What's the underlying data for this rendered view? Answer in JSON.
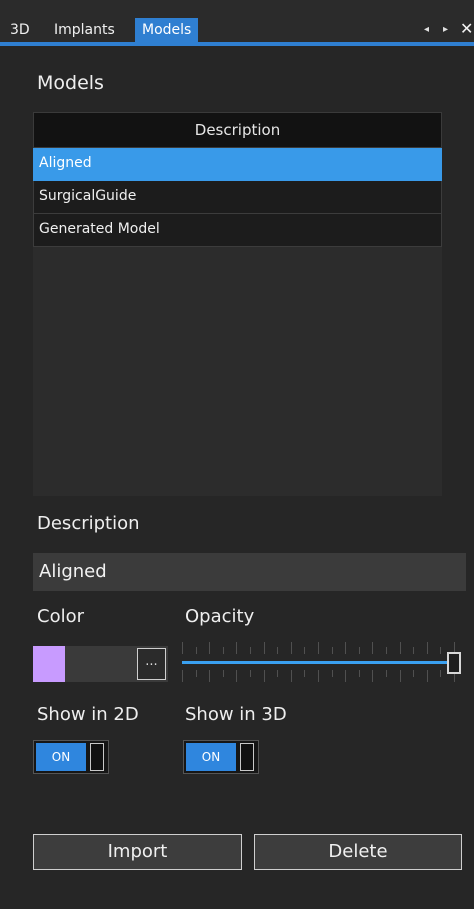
{
  "tabs": [
    {
      "label": "3D",
      "active": false
    },
    {
      "label": "Implants",
      "active": false
    },
    {
      "label": "Models",
      "active": true
    }
  ],
  "tab_nav": {
    "prev_glyph": "◂",
    "next_glyph": "▸",
    "close_glyph": "✕"
  },
  "panel": {
    "title": "Models",
    "list": {
      "header": "Description",
      "rows": [
        "Aligned",
        "SurgicalGuide",
        "Generated Model"
      ],
      "selected_index": 0
    },
    "description_label": "Description",
    "description_value": "Aligned",
    "color_label": "Color",
    "color_value": "#c89bff",
    "more_label": "...",
    "opacity_label": "Opacity",
    "opacity_value": 1.0,
    "show2d_label": "Show in 2D",
    "show2d_state": "ON",
    "show3d_label": "Show in 3D",
    "show3d_state": "ON",
    "import_label": "Import",
    "delete_label": "Delete"
  },
  "colors": {
    "accent": "#2f7fd1",
    "selection": "#399ae9",
    "swatch": "#c89bff"
  }
}
